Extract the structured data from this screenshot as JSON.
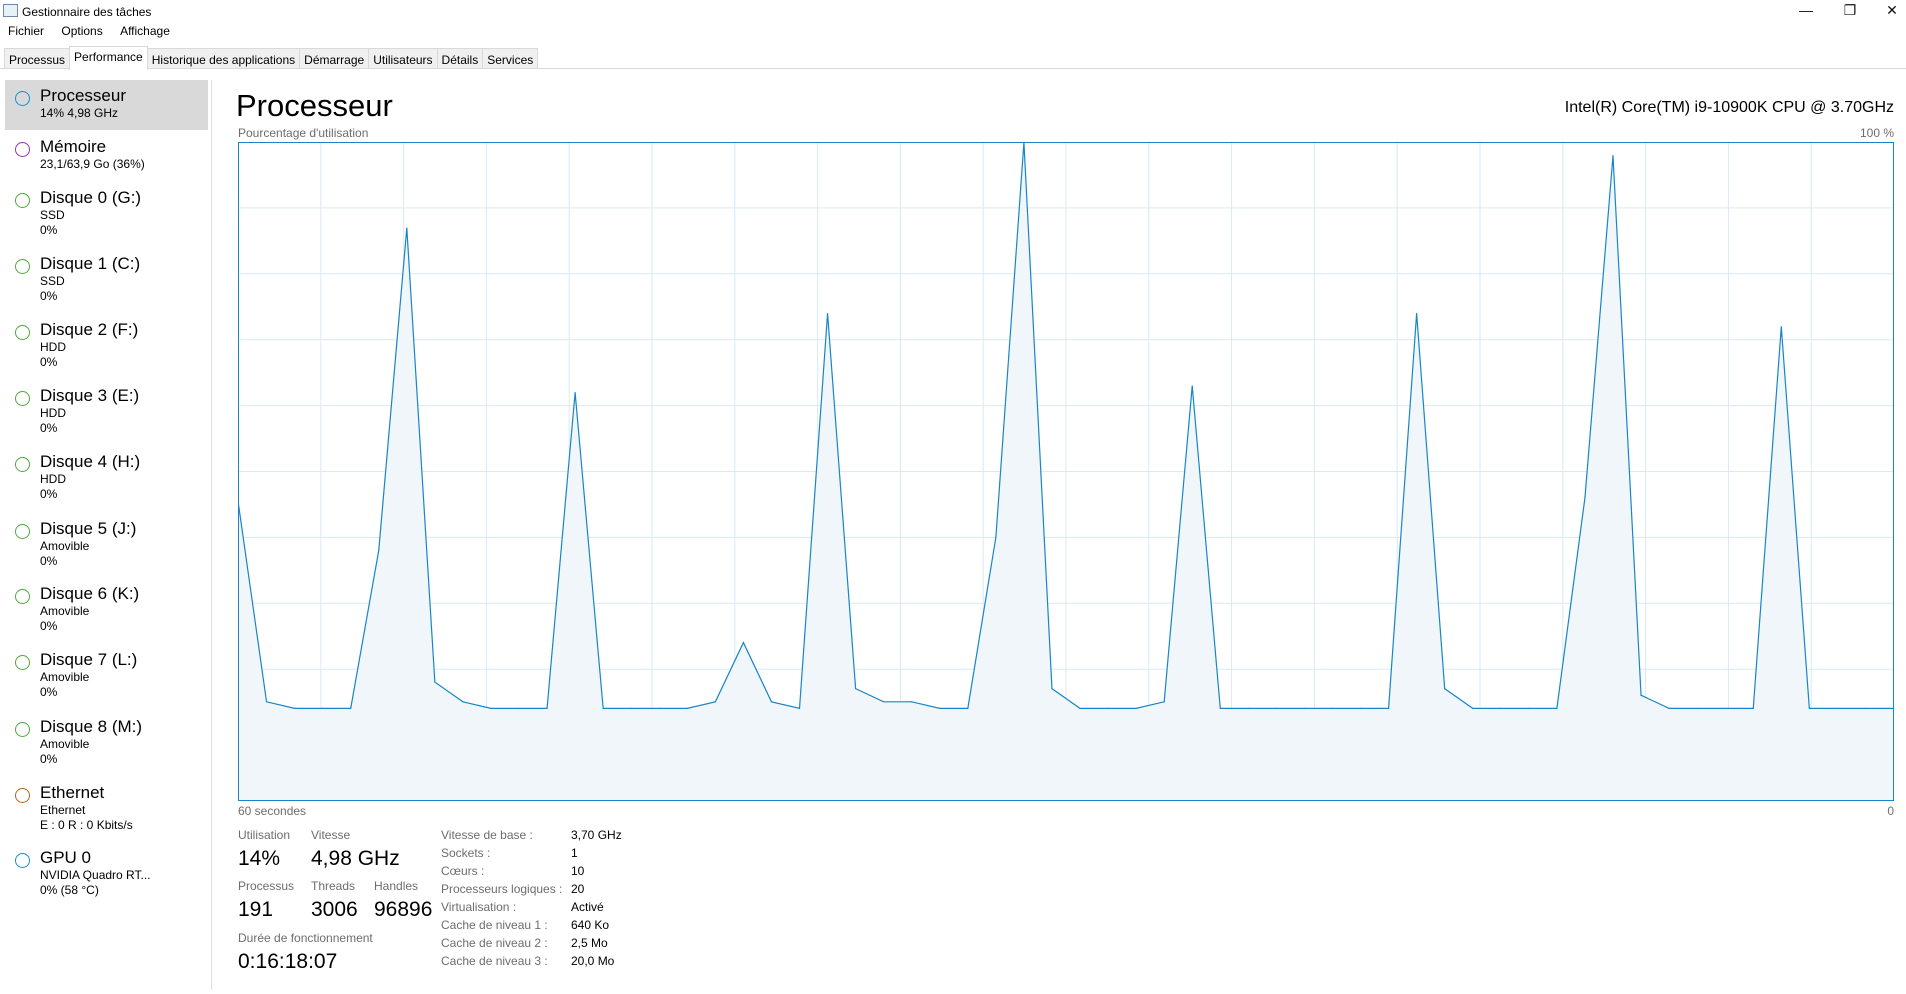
{
  "window": {
    "title": "Gestionnaire des tâches",
    "minimize": "—",
    "restore": "❐",
    "close": "✕"
  },
  "menu": [
    "Fichier",
    "Options",
    "Affichage"
  ],
  "tabs": [
    "Processus",
    "Performance",
    "Historique des applications",
    "Démarrage",
    "Utilisateurs",
    "Détails",
    "Services"
  ],
  "active_tab": 1,
  "sidebar": [
    {
      "name": "Processeur",
      "l1": "14%  4,98 GHz",
      "color": "#1a8fd0",
      "selected": true
    },
    {
      "name": "Mémoire",
      "l1": "23,1/63,9 Go (36%)",
      "color": "#9b2dbd"
    },
    {
      "name": "Disque 0 (G:)",
      "l1": "SSD",
      "l2": "0%",
      "color": "#4daa3a"
    },
    {
      "name": "Disque 1 (C:)",
      "l1": "SSD",
      "l2": "0%",
      "color": "#4daa3a"
    },
    {
      "name": "Disque 2 (F:)",
      "l1": "HDD",
      "l2": "0%",
      "color": "#4daa3a"
    },
    {
      "name": "Disque 3 (E:)",
      "l1": "HDD",
      "l2": "0%",
      "color": "#4daa3a"
    },
    {
      "name": "Disque 4 (H:)",
      "l1": "HDD",
      "l2": "0%",
      "color": "#4daa3a"
    },
    {
      "name": "Disque 5 (J:)",
      "l1": "Amovible",
      "l2": "0%",
      "color": "#4daa3a"
    },
    {
      "name": "Disque 6 (K:)",
      "l1": "Amovible",
      "l2": "0%",
      "color": "#4daa3a"
    },
    {
      "name": "Disque 7 (L:)",
      "l1": "Amovible",
      "l2": "0%",
      "color": "#4daa3a"
    },
    {
      "name": "Disque 8 (M:)",
      "l1": "Amovible",
      "l2": "0%",
      "color": "#4daa3a"
    },
    {
      "name": "Ethernet",
      "l1": "Ethernet",
      "l2": "E : 0 R : 0 Kbits/s",
      "color": "#b5651d"
    },
    {
      "name": "GPU 0",
      "l1": "NVIDIA Quadro RT...",
      "l2": "0%  (58 °C)",
      "color": "#1a8fd0"
    }
  ],
  "main": {
    "title": "Processeur",
    "cpu": "Intel(R) Core(TM) i9-10900K CPU @ 3.70GHz",
    "chart_label": "Pourcentage d'utilisation",
    "max_label": "100 %",
    "time_label": "60 secondes",
    "min_label": "0"
  },
  "chart_data": {
    "type": "area",
    "title": "Pourcentage d'utilisation",
    "xlabel": "60 secondes",
    "ylim": [
      0,
      100
    ],
    "color": "#1785c8",
    "fill": "#f1f6fa",
    "values": [
      45,
      15,
      14,
      14,
      14,
      38,
      87,
      18,
      15,
      14,
      14,
      14,
      62,
      14,
      14,
      14,
      14,
      15,
      24,
      15,
      14,
      74,
      17,
      15,
      15,
      14,
      14,
      40,
      100,
      17,
      14,
      14,
      14,
      15,
      63,
      14,
      14,
      14,
      14,
      14,
      14,
      14,
      74,
      17,
      14,
      14,
      14,
      14,
      46,
      98,
      16,
      14,
      14,
      14,
      14,
      72,
      14,
      14,
      14,
      14
    ]
  },
  "stats": {
    "util_label": "Utilisation",
    "util": "14%",
    "speed_label": "Vitesse",
    "speed": "4,98 GHz",
    "proc_label": "Processus",
    "proc": "191",
    "threads_label": "Threads",
    "threads": "3006",
    "handles_label": "Handles",
    "handles": "96896",
    "uptime_label": "Durée de fonctionnement",
    "uptime": "0:16:18:07"
  },
  "specs": [
    [
      "Vitesse de base :",
      "3,70 GHz"
    ],
    [
      "Sockets :",
      "1"
    ],
    [
      "Cœurs :",
      "10"
    ],
    [
      "Processeurs logiques :",
      "20"
    ],
    [
      "Virtualisation :",
      "Activé"
    ],
    [
      "Cache de niveau 1 :",
      "640 Ko"
    ],
    [
      "Cache de niveau 2 :",
      "2,5 Mo"
    ],
    [
      "Cache de niveau 3 :",
      "20,0 Mo"
    ]
  ]
}
